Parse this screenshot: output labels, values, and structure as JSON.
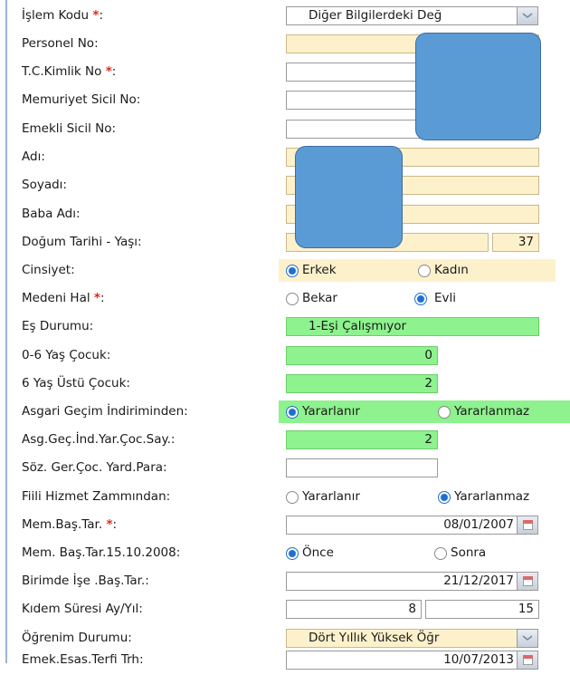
{
  "form": {
    "islem_kodu": {
      "label": "İşlem Kodu",
      "required": "*",
      "colon": ":",
      "value": "Diğer Bilgilerdeki Değ"
    },
    "personel_no": {
      "label": "Personel No:",
      "value": ""
    },
    "tc_kimlik": {
      "label": "T.C.Kimlik No",
      "required": "*",
      "colon": ":",
      "value": "2"
    },
    "memuriyet_sicil": {
      "label": "Memuriyet Sicil No:",
      "value": ""
    },
    "emekli_sicil": {
      "label": "Emekli Sicil No:",
      "value": ""
    },
    "adi": {
      "label": "Adı:",
      "value": ""
    },
    "soyadi": {
      "label": "Soyadı:",
      "value": ""
    },
    "baba_adi": {
      "label": "Baba Adı:",
      "value": ""
    },
    "dogum": {
      "label": "Doğum Tarihi - Yaşı:",
      "date": "",
      "age": "37"
    },
    "cinsiyet": {
      "label": "Cinsiyet:",
      "options": [
        "Erkek",
        "Kadın"
      ],
      "selected": 0
    },
    "medeni_hal": {
      "label": "Medeni Hal",
      "required": "*",
      "colon": ":",
      "options": [
        "Bekar",
        "Evli"
      ],
      "selected": 1
    },
    "es_durumu": {
      "label": "Eş Durumu:",
      "value": "1-Eşi Çalışmıyor"
    },
    "cocuk_0_6": {
      "label": "0-6 Yaş Çocuk:",
      "value": "0"
    },
    "cocuk_6_ustu": {
      "label": "6 Yaş Üstü Çocuk:",
      "value": "2"
    },
    "agi": {
      "label": "Asgari Geçim İndiriminden:",
      "options": [
        "Yararlanır",
        "Yararlanmaz"
      ],
      "selected": 0
    },
    "agi_cocuk": {
      "label": "Asg.Geç.İnd.Yar.Çoc.Say.:",
      "value": "2"
    },
    "soz_cocuk": {
      "label": "Söz. Ger.Çoc. Yard.Para:",
      "value": ""
    },
    "fiili_hizmet": {
      "label": "Fiili Hizmet Zammından:",
      "options": [
        "Yararlanır",
        "Yararlanmaz"
      ],
      "selected": 1
    },
    "mem_bas_tar": {
      "label": "Mem.Baş.Tar.",
      "required": "*",
      "colon": ":",
      "value": "08/01/2007"
    },
    "mem_bas_2008": {
      "label": "Mem. Baş.Tar.15.10.2008:",
      "options": [
        "Önce",
        "Sonra"
      ],
      "selected": 0
    },
    "birim_ise_bas": {
      "label": "Birimde İşe .Baş.Tar.:",
      "value": "21/12/2017"
    },
    "kidem": {
      "label": "Kıdem Süresi Ay/Yıl:",
      "ay": "8",
      "yil": "15"
    },
    "ogrenim": {
      "label": "Öğrenim Durumu:",
      "value": "Dört Yıllık Yüksek Öğr"
    },
    "emek_terfi": {
      "label": "Emek.Esas.Terfi Trh:",
      "value": "10/07/2013"
    }
  },
  "colors": {
    "required": "#e0281e",
    "readonly_yellow": "#fdf1cc",
    "computed_green": "#8ef28e",
    "radio_on": "#1e6fd0",
    "redaction": "#5b9bd5"
  }
}
